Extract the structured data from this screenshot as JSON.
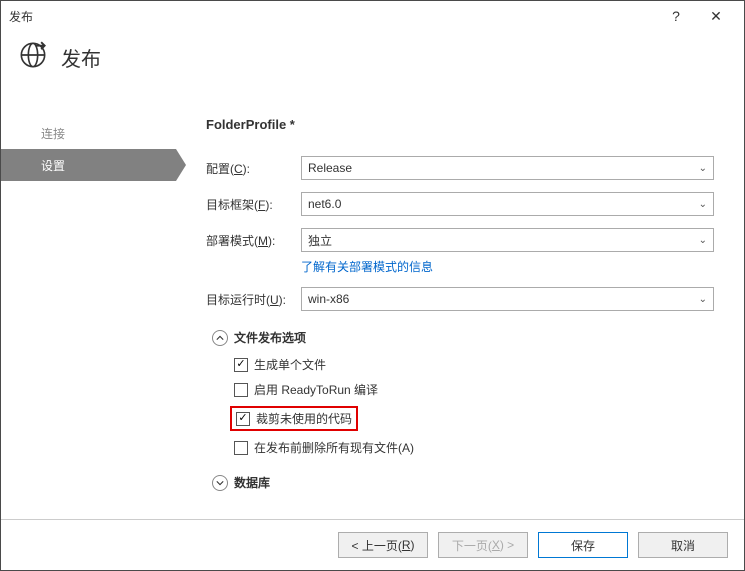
{
  "titlebar": {
    "title": "发布",
    "help": "?",
    "close": "✕"
  },
  "header": {
    "title": "发布"
  },
  "sidebar": {
    "items": [
      {
        "label": "连接",
        "active": false
      },
      {
        "label": "设置",
        "active": true
      }
    ]
  },
  "profile": {
    "name": "FolderProfile *"
  },
  "form": {
    "configuration": {
      "label": "配置(",
      "mnemonic": "C",
      "suffix": "):",
      "value": "Release"
    },
    "framework": {
      "label": "目标框架(",
      "mnemonic": "F",
      "suffix": "):",
      "value": "net6.0"
    },
    "deployment": {
      "label": "部署模式(",
      "mnemonic": "M",
      "suffix": "):",
      "value": "独立"
    },
    "deployment_link": "了解有关部署模式的信息",
    "runtime": {
      "label": "目标运行时(",
      "mnemonic": "U",
      "suffix": "):",
      "value": "win-x86"
    }
  },
  "sections": {
    "filePublish": {
      "title": "文件发布选项",
      "expanded": true,
      "options": [
        {
          "label": "生成单个文件",
          "checked": true,
          "highlighted": false
        },
        {
          "label": "启用 ReadyToRun 编译",
          "checked": false,
          "highlighted": false
        },
        {
          "label": "裁剪未使用的代码",
          "checked": true,
          "highlighted": true
        },
        {
          "label": "在发布前删除所有现有文件(",
          "mnemonic": "A",
          "suffix": ")",
          "checked": false,
          "highlighted": false
        }
      ]
    },
    "database": {
      "title": "数据库",
      "expanded": false
    }
  },
  "footer": {
    "prev": {
      "text": "< 上一页(",
      "mnemonic": "R",
      "suffix": ")",
      "enabled": true
    },
    "next": {
      "text": "下一页(",
      "mnemonic": "X",
      "suffix": ") >",
      "enabled": false
    },
    "save": {
      "text": "保存",
      "primary": true
    },
    "cancel": {
      "text": "取消"
    }
  }
}
